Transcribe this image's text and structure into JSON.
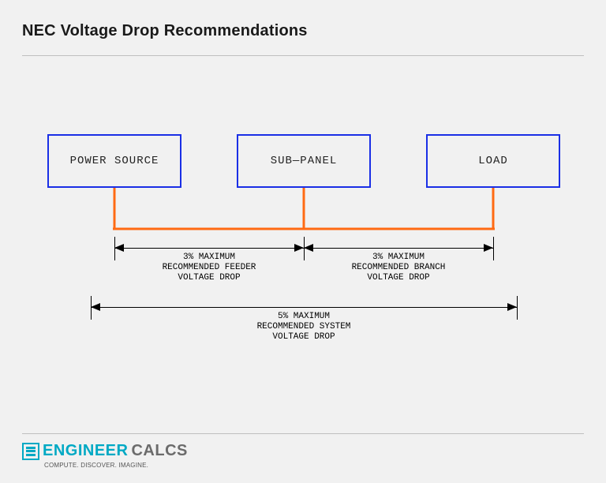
{
  "title": "NEC Voltage Drop Recommendations",
  "boxes": {
    "source": "POWER SOURCE",
    "panel": "SUB—PANEL",
    "load": "LOAD"
  },
  "dims": {
    "feeder": "3% MAXIMUM\nRECOMMENDED FEEDER\nVOLTAGE DROP",
    "branch": "3% MAXIMUM\nRECOMMENDED BRANCH\nVOLTAGE DROP",
    "system": "5% MAXIMUM\nRECOMMENDED SYSTEM\nVOLTAGE DROP"
  },
  "logo": {
    "engineer": "ENGINEER",
    "calcs": "CALCS",
    "tagline": "COMPUTE. DISCOVER. IMAGINE."
  }
}
